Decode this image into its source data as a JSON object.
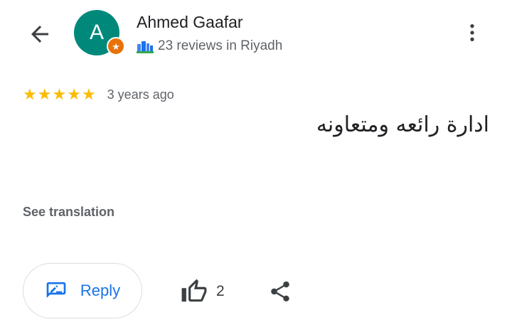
{
  "header": {
    "back_icon": "arrow-back-icon",
    "more_icon": "more-vert-icon"
  },
  "author": {
    "avatar_letter": "A",
    "avatar_color": "#00897b",
    "badge_icon": "local-guide-star-icon",
    "badge_color": "#e8710a",
    "name": "Ahmed Gaafar",
    "meta_icon": "local-guide-city-icon",
    "meta": "23 reviews in Riyadh"
  },
  "review": {
    "rating": 5,
    "max_rating": 5,
    "star_color": "#fbbc04",
    "stars": [
      "★",
      "★",
      "★",
      "★",
      "★"
    ],
    "time_ago": "3 years ago",
    "text": "ادارة رائعه ومتعاونه",
    "see_translation": "See translation"
  },
  "actions": {
    "reply_icon": "reply-edit-icon",
    "reply_label": "Reply",
    "reply_color": "#1a73e8",
    "like_icon": "thumb-up-icon",
    "like_count": "2",
    "share_icon": "share-icon"
  }
}
